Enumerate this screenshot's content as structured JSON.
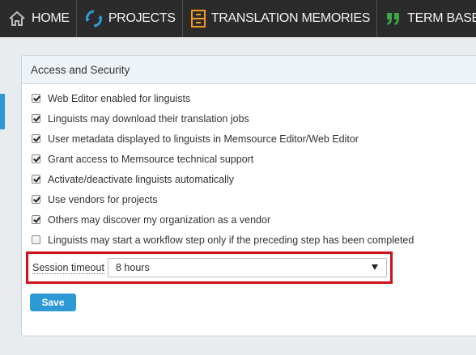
{
  "nav": {
    "items": [
      {
        "label": "HOME",
        "icon": "home-icon"
      },
      {
        "label": "PROJECTS",
        "icon": "projects-icon"
      },
      {
        "label": "TRANSLATION MEMORIES",
        "icon": "translation-memories-icon"
      },
      {
        "label": "TERM BASES",
        "icon": "term-bases-icon"
      }
    ],
    "colors": {
      "background": "#2b2b2b",
      "text": "#f2f2f2",
      "projects_icon": "#2d9ad6",
      "tm_icon": "#f29b1d",
      "tb_icon": "#3aa845"
    }
  },
  "panel": {
    "title": "Access and Security",
    "options": [
      {
        "label": "Web Editor enabled for linguists",
        "checked": true
      },
      {
        "label": "Linguists may download their translation jobs",
        "checked": true
      },
      {
        "label": "User metadata displayed to linguists in Memsource Editor/Web Editor",
        "checked": true
      },
      {
        "label": "Grant access to Memsource technical support",
        "checked": true
      },
      {
        "label": "Activate/deactivate linguists automatically",
        "checked": true
      },
      {
        "label": "Use vendors for projects",
        "checked": true
      },
      {
        "label": "Others may discover my organization as a vendor",
        "checked": true
      },
      {
        "label": "Linguists may start a workflow step only if the preceding step has been completed",
        "checked": false
      }
    ],
    "session_timeout": {
      "label": "Session timeout",
      "selected": "8 hours",
      "highlight_color": "#d0101b"
    },
    "save_label": "Save",
    "accent_color": "#2d9ad6"
  }
}
